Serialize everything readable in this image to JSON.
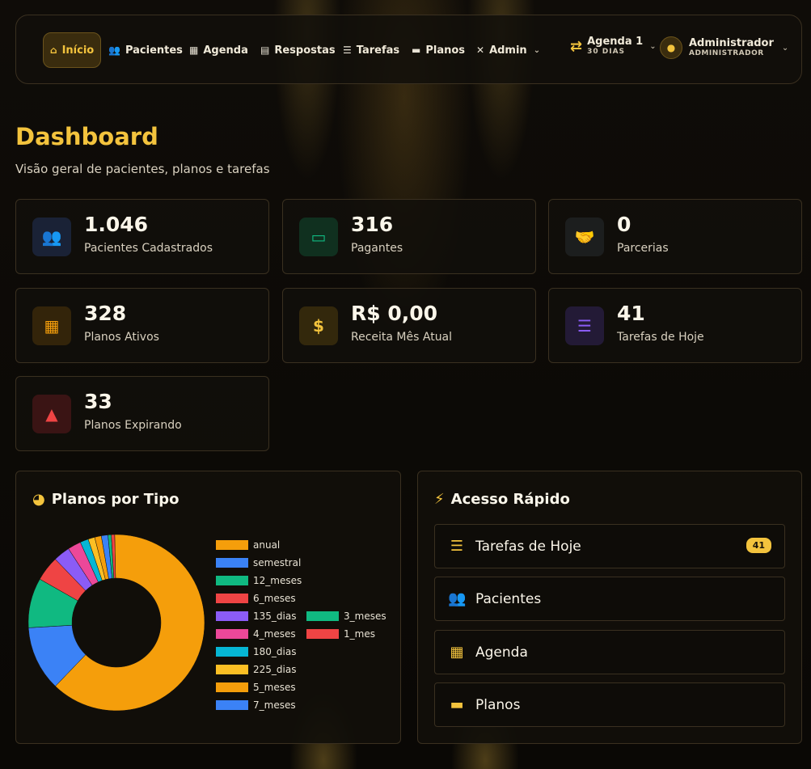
{
  "nav": {
    "items": [
      {
        "label": "Início",
        "icon": "home-icon"
      },
      {
        "label": "Pacientes",
        "icon": "users-icon"
      },
      {
        "label": "Agenda",
        "icon": "calendar-icon"
      },
      {
        "label": "Respostas",
        "icon": "clipboard-icon"
      },
      {
        "label": "Tarefas",
        "icon": "tasks-icon"
      },
      {
        "label": "Planos",
        "icon": "card-icon"
      },
      {
        "label": "Admin",
        "icon": "tools-icon"
      }
    ],
    "agenda": {
      "title": "Agenda 1",
      "subtitle": "30 DIAS"
    },
    "user": {
      "name": "Administrador",
      "role": "ADMINISTRADOR"
    }
  },
  "page": {
    "title": "Dashboard",
    "subtitle": "Visão geral de pacientes, planos e tarefas"
  },
  "stats": [
    {
      "value": "1.046",
      "label": "Pacientes Cadastrados",
      "icon": "users-icon",
      "color": "#3b82f6"
    },
    {
      "value": "316",
      "label": "Pagantes",
      "icon": "card-icon",
      "color": "#10b981"
    },
    {
      "value": "0",
      "label": "Parcerias",
      "icon": "handshake-icon",
      "color": "#34d399"
    },
    {
      "value": "328",
      "label": "Planos Ativos",
      "icon": "calendar-check-icon",
      "color": "#f59e0b"
    },
    {
      "value": "R$ 0,00",
      "label": "Receita Mês Atual",
      "icon": "dollar-icon",
      "color": "#f3c33d"
    },
    {
      "value": "41",
      "label": "Tarefas de Hoje",
      "icon": "list-check-icon",
      "color": "#8b5cf6"
    },
    {
      "value": "33",
      "label": "Planos Expirando",
      "icon": "warning-icon",
      "color": "#ef4444"
    }
  ],
  "plans_panel": {
    "title": "Planos por Tipo"
  },
  "chart_data": {
    "type": "pie",
    "donut": true,
    "categories": [
      "anual",
      "semestral",
      "12_meses",
      "6_meses",
      "135_dias",
      "4_meses",
      "180_dias",
      "225_dias",
      "5_meses",
      "7_meses",
      "3_meses",
      "1_mes"
    ],
    "values": [
      205,
      39,
      30,
      15,
      10,
      8,
      5,
      4,
      4,
      4,
      2,
      2
    ],
    "colors": [
      "#f59e0b",
      "#3b82f6",
      "#10b981",
      "#ef4444",
      "#8b5cf6",
      "#ec4899",
      "#06b6d4",
      "#fbbf24",
      "#f59e0b",
      "#3b82f6",
      "#10b981",
      "#ef4444"
    ],
    "legend_position": "right"
  },
  "quick_access": {
    "title": "Acesso Rápido",
    "items": [
      {
        "label": "Tarefas de Hoje",
        "icon": "list-check-icon",
        "badge": "41"
      },
      {
        "label": "Pacientes",
        "icon": "users-icon"
      },
      {
        "label": "Agenda",
        "icon": "calendar-icon"
      },
      {
        "label": "Planos",
        "icon": "card-icon"
      }
    ]
  }
}
